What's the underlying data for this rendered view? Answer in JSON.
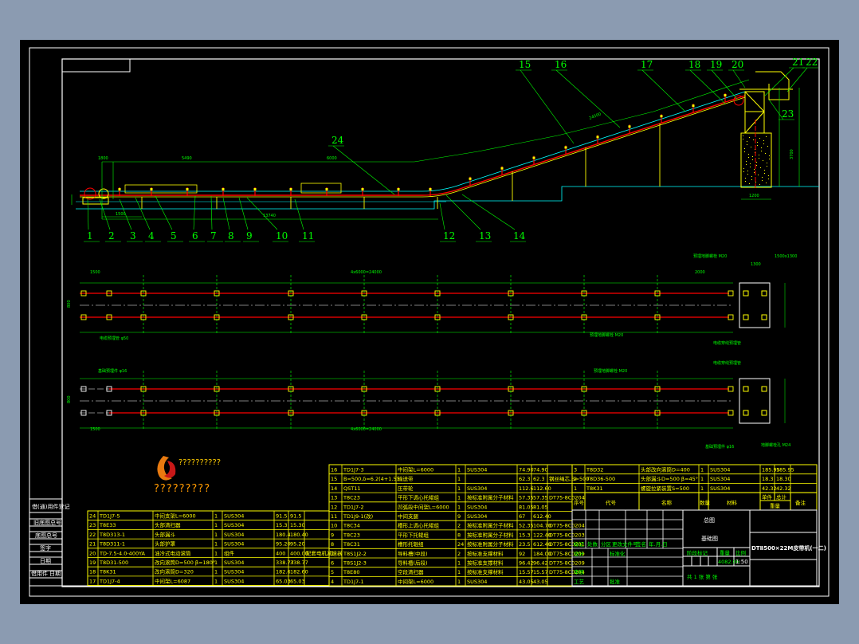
{
  "colors": {
    "background": "#8b9bb1",
    "canvas": "#000000",
    "frame": "#ffffff",
    "table": "#ffff00",
    "leader": "#00ff00",
    "belt": "#ff0000",
    "idler": "#00ffff"
  },
  "balloons": [
    "1",
    "2",
    "3",
    "4",
    "5",
    "6",
    "7",
    "8",
    "9",
    "10",
    "11",
    "12",
    "13",
    "14",
    "15",
    "16",
    "17",
    "18",
    "19",
    "20",
    "21",
    "22",
    "23",
    "24"
  ],
  "dimensions": {
    "overall": "13740",
    "span1": "5490",
    "span2": "6000",
    "left_gap": "1800",
    "height_total": "3700",
    "found_width": "1200",
    "plan_total": "4x6000=24000",
    "plan_left": "1500",
    "plan_right": "2000",
    "plan_found": "1300",
    "plan_width": "800",
    "slope": "24500"
  },
  "plan_notes": {
    "top_left": "电缆预埋管 φ50",
    "top_right1": "预埋地脚螺栓 M20",
    "top_right2": "1500x1300",
    "mid_right": "电缆穿线预埋管",
    "bottom_left": "基础预埋件 φ16",
    "bottom_right": "地脚螺栓孔 M24"
  },
  "logo": {
    "text": "?????????",
    "subtitle": "??????????"
  },
  "left_stamp": [
    "借(通)用件登记",
    "旧底图总号",
    "底图总号",
    "签字",
    "日期",
    "借用件",
    "日期"
  ],
  "parts_left": [
    [
      "24",
      "TD1J7-5",
      "中间支架L=6000",
      "1",
      "SUS304",
      "91.5",
      "91.5",
      ""
    ],
    [
      "23",
      "T8E33",
      "头部清扫器",
      "1",
      "SUS304",
      "15.3",
      "15.30",
      ""
    ],
    [
      "22",
      "T8D313-1",
      "头部漏斗",
      "1",
      "SUS304",
      "180.4",
      "180.40",
      ""
    ],
    [
      "21",
      "T8D311-1",
      "头部护罩",
      "1",
      "SUS304",
      "95.20",
      "95.20",
      ""
    ],
    [
      "20",
      "TD-7.5-4.0-400YA",
      "油冷式电动滚筒",
      "1",
      "组件",
      "400",
      "400.00",
      "配套电机减速器"
    ],
    [
      "19",
      "T8D31-500",
      "改向滚筒D=500 β=180°",
      "1",
      "SUS304",
      "338.77",
      "338.77",
      ""
    ],
    [
      "18",
      "T8K31",
      "改向滚筒D=320",
      "1",
      "SUS304",
      "182.6",
      "182.60",
      ""
    ],
    [
      "17",
      "TD1J7-4",
      "中间架L=6087",
      "1",
      "SUS304",
      "65.03",
      "65.03",
      ""
    ]
  ],
  "parts_mid": [
    [
      "16",
      "TD1J7-3",
      "中间架L=6000",
      "1",
      "SUS304",
      "74.90",
      "74.90",
      ""
    ],
    [
      "15",
      "B=500,δ=6.2(4+1.5)",
      "输送带",
      "1",
      "",
      "62.3",
      "62.3",
      "钢丝绳芯,B=500"
    ],
    [
      "14",
      "QST11",
      "压带轮",
      "1",
      "SUS304",
      "112.6",
      "112.60",
      ""
    ],
    [
      "13",
      "T8C23",
      "平形下调心托辊组",
      "1",
      "按标准附属分子材料",
      "57.35",
      "57.35",
      "DT75-8C0204"
    ],
    [
      "12",
      "TD1J7-2",
      "凹弧段中间架L=6000",
      "1",
      "SUS304",
      "81.05",
      "81.05",
      ""
    ],
    [
      "11",
      "TD1J9-1(改)",
      "中间支腿",
      "9",
      "SUS304",
      "67",
      "612.40",
      ""
    ],
    [
      "10",
      "T8C34",
      "槽形上调心托辊组",
      "2",
      "按标准附属分子材料",
      "52.35",
      "104.70",
      "DT75-8C0204"
    ],
    [
      "9",
      "T8C23",
      "平形下托辊组",
      "8",
      "按标准附属分子材料",
      "15.3",
      "122.40",
      "DT75-8C0203"
    ],
    [
      "8",
      "T8C31",
      "槽形托辊组",
      "24",
      "按标准附属分子材料",
      "23.5",
      "612.40",
      "DT75-8C0201"
    ],
    [
      "7",
      "T8S1J2-2",
      "导料槽(中段)",
      "2",
      "按标准支撑材料",
      "92",
      "184.00",
      "DT75-8C0209"
    ],
    [
      "6",
      "T8S1J2-3",
      "导料槽(后段)",
      "1",
      "按标准支撑材料",
      "96.42",
      "96.42",
      "DT75-8C0209"
    ],
    [
      "5",
      "T8E80",
      "空段清扫器",
      "1",
      "按标准支撑材料",
      "15.57",
      "15.57",
      "DT75-8C0204"
    ],
    [
      "4",
      "TD1J7-1",
      "中间架L=6000",
      "1",
      "SUS304",
      "43.05",
      "43.05",
      ""
    ]
  ],
  "parts_right": [
    [
      "3",
      "T8D32",
      "头部改向滚筒D=400",
      "1",
      "SUS304",
      "185.95",
      "185.95",
      ""
    ],
    [
      "2",
      "T8D36-500",
      "头部漏斗D=500 β=45°",
      "1",
      "SUS304",
      "18.3",
      "18.30",
      ""
    ],
    [
      "1",
      "T8K31",
      "螺旋拉紧装置S=500",
      "1",
      "SUS304",
      "42.32",
      "42.32",
      ""
    ]
  ],
  "parts_header": {
    "no": "序号",
    "code": "代号",
    "name": "名称",
    "qty": "数量",
    "material": "材料",
    "unit": "单件",
    "total": "总计",
    "weight": "重量",
    "note": "备注"
  },
  "revision_block": {
    "cols": [
      "标记",
      "处数",
      "分区",
      "更改文件号",
      "签名",
      "年.月.日"
    ],
    "design": "设计",
    "standard": "标准化",
    "check": "审核",
    "process": "工艺",
    "approve": "批准"
  },
  "title_block": {
    "title1": "总图",
    "title2": "基础图",
    "drawing_name": "DTⅡ500×22M皮带机(一二)",
    "stage": "阶段标记",
    "weight": "重量",
    "scale": "比例",
    "weight_value": "4082.06",
    "scale_value": "1:50",
    "sheets": "共 1 张  第  张"
  }
}
